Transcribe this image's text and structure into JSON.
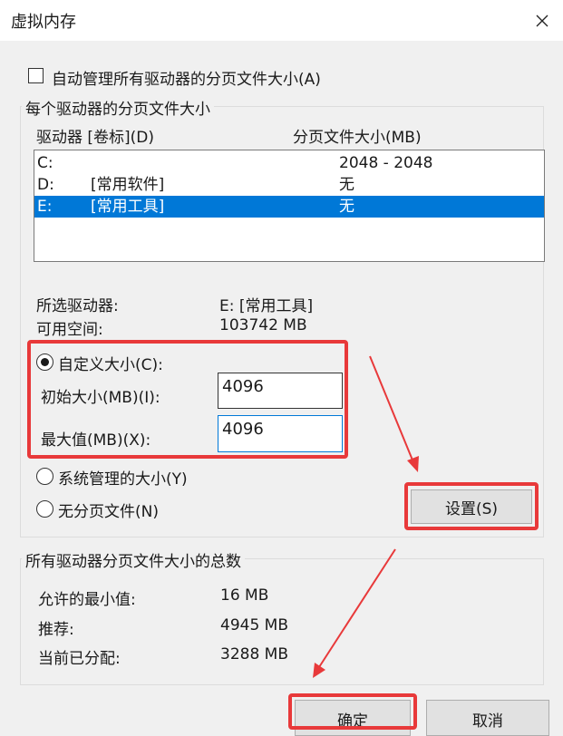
{
  "window": {
    "title": "虚拟内存"
  },
  "auto_manage": {
    "label": "自动管理所有驱动器的分页文件大小(A)",
    "checked": false
  },
  "per_drive": {
    "group_title": "每个驱动器的分页文件大小",
    "col_drive": "驱动器 [卷标](D)",
    "col_size": "分页文件大小(MB)",
    "rows": [
      {
        "drive": "C:",
        "label": "",
        "size": "2048 - 2048",
        "selected": false
      },
      {
        "drive": "D:",
        "label": "[常用软件]",
        "size": "无",
        "selected": false
      },
      {
        "drive": "E:",
        "label": "[常用工具]",
        "size": "无",
        "selected": true
      }
    ],
    "selected_drive_label": "所选驱动器:",
    "selected_drive_value": "E:  [常用工具]",
    "free_space_label": "可用空间:",
    "free_space_value": "103742 MB",
    "custom_size_label": "自定义大小(C):",
    "initial_size_label": "初始大小(MB)(I):",
    "initial_size_value": "4096",
    "max_size_label": "最大值(MB)(X):",
    "max_size_value": "4096",
    "system_managed_label": "系统管理的大小(Y)",
    "no_paging_label": "无分页文件(N)",
    "set_button": "设置(S)"
  },
  "totals": {
    "group_title": "所有驱动器分页文件大小的总数",
    "min_label": "允许的最小值:",
    "min_value": "16 MB",
    "recommended_label": "推荐:",
    "recommended_value": "4945 MB",
    "current_label": "当前已分配:",
    "current_value": "3288 MB"
  },
  "buttons": {
    "ok": "确定",
    "cancel": "取消"
  },
  "colors": {
    "highlight": "#0078d7",
    "annotation_red": "#e8393a"
  }
}
